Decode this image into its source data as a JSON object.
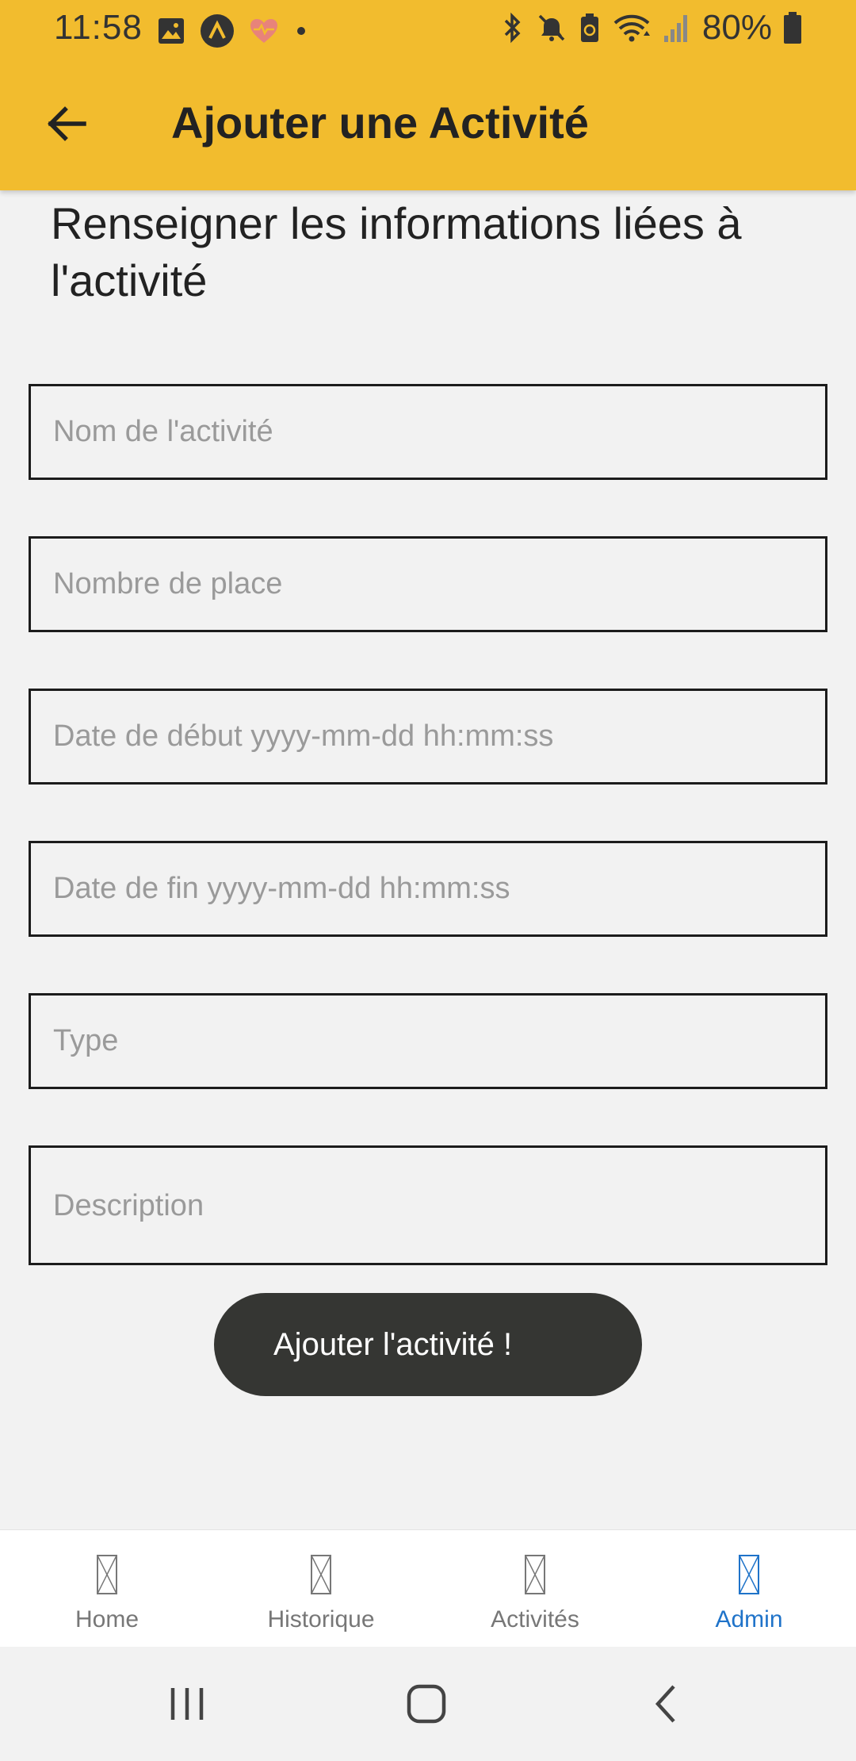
{
  "status_bar": {
    "time": "11:58",
    "battery": "80%",
    "left_icons": [
      "image-icon",
      "expo-icon",
      "health-icon",
      "dot-icon"
    ],
    "right_icons": [
      "bluetooth-icon",
      "mute-icon",
      "battery-saver-icon",
      "wifi-icon",
      "signal-icon",
      "battery-icon"
    ]
  },
  "toolbar": {
    "title": "Ajouter une Activité",
    "back_icon": "arrow-back-icon",
    "background_color": "#f2bc2e"
  },
  "form": {
    "intro": "Renseigner les informations liées à l'activité",
    "fields": {
      "name": {
        "placeholder": "Nom de l'activité",
        "value": ""
      },
      "places": {
        "placeholder": "Nombre de place",
        "value": ""
      },
      "start_date": {
        "placeholder": "Date de début yyyy-mm-dd hh:mm:ss",
        "value": ""
      },
      "end_date": {
        "placeholder": "Date de fin yyyy-mm-dd hh:mm:ss",
        "value": ""
      },
      "type": {
        "placeholder": "Type",
        "value": ""
      },
      "description": {
        "placeholder": "Description",
        "value": ""
      }
    },
    "submit_label": "Ajouter l'activité !"
  },
  "bottom_nav": {
    "active_color": "#1f73c9",
    "items": [
      {
        "label": "Home",
        "icon": "missing-glyph-icon",
        "active": false
      },
      {
        "label": "Historique",
        "icon": "missing-glyph-icon",
        "active": false
      },
      {
        "label": "Activités",
        "icon": "missing-glyph-icon",
        "active": false
      },
      {
        "label": "Admin",
        "icon": "missing-glyph-icon",
        "active": true
      }
    ]
  },
  "system_nav": {
    "buttons": [
      "recents-icon",
      "home-icon",
      "back-icon"
    ]
  }
}
